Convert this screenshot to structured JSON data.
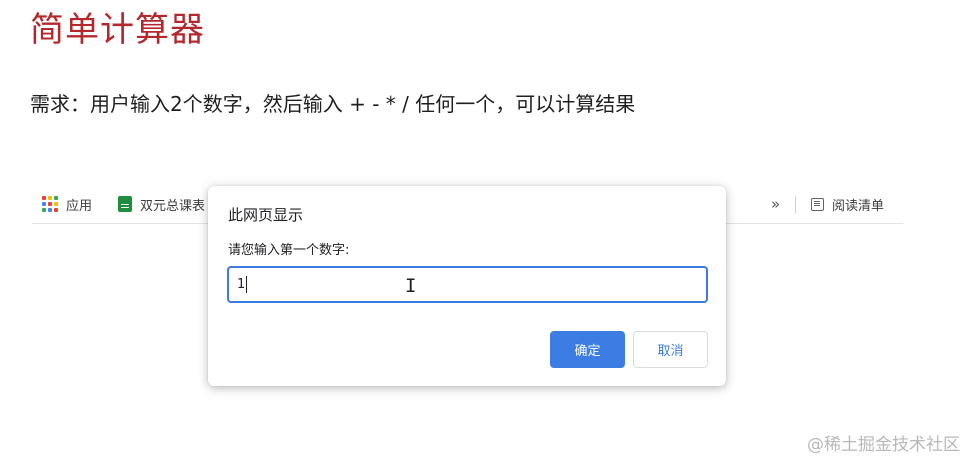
{
  "slide": {
    "title": "简单计算器",
    "requirement": "需求：用户输入2个数字，然后输入 + - *  /  任何一个，可以计算结果"
  },
  "bookmarks": {
    "apps_label": "应用",
    "apps_icon": "apps-grid-icon",
    "apps_colors": [
      "#ea4335",
      "#fbbc05",
      "#34a853",
      "#4285f4",
      "#ea4335",
      "#fbbc05",
      "#34a853",
      "#4285f4",
      "#ea4335"
    ],
    "sheet_label": "双元总课表",
    "sheet_icon": "spreadsheet-icon",
    "more_label": "»",
    "reading_label": "阅读清单",
    "reading_icon": "reading-list-icon"
  },
  "dialog": {
    "title": "此网页显示",
    "message": "请您输入第一个数字:",
    "input_value": "1",
    "ok_label": "确定",
    "cancel_label": "取消",
    "accent": "#3c7de4"
  },
  "watermark": "@稀土掘金技术社区"
}
